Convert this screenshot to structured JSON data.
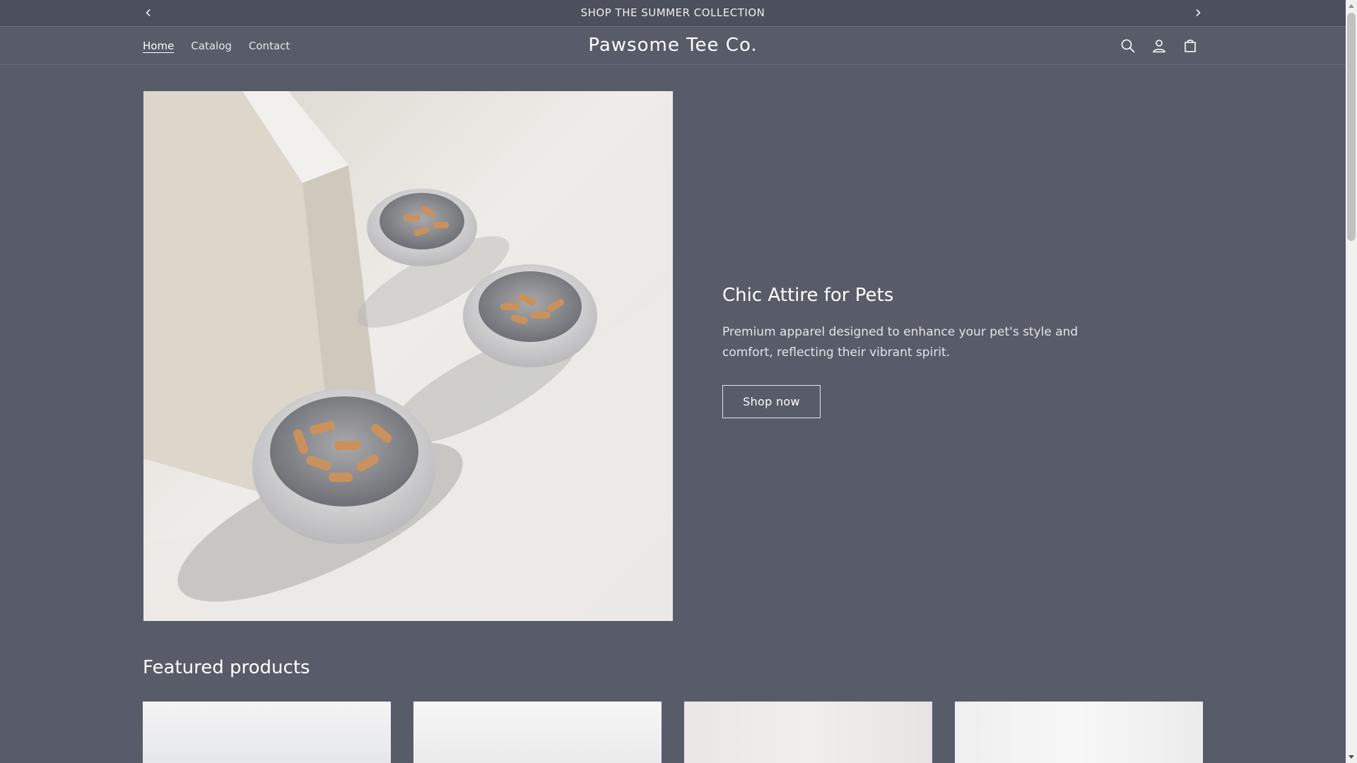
{
  "announcement": {
    "text": "SHOP THE SUMMER COLLECTION",
    "prev_icon": "chevron-left-icon",
    "next_icon": "chevron-right-icon"
  },
  "header": {
    "nav": [
      {
        "label": "Home",
        "active": true
      },
      {
        "label": "Catalog",
        "active": false
      },
      {
        "label": "Contact",
        "active": false
      }
    ],
    "logo": "Pawsome Tee Co.",
    "icons": [
      "search-icon",
      "account-icon",
      "cart-icon"
    ]
  },
  "hero": {
    "title": "Chic Attire for Pets",
    "description": "Premium apparel designed to enhance your pet's style and comfort, reflecting their vibrant spirit.",
    "button_label": "Shop now"
  },
  "featured": {
    "heading": "Featured products"
  },
  "colors": {
    "background": "#585b68",
    "announcement_bg": "#4c4f5c",
    "text": "#ffffff"
  }
}
